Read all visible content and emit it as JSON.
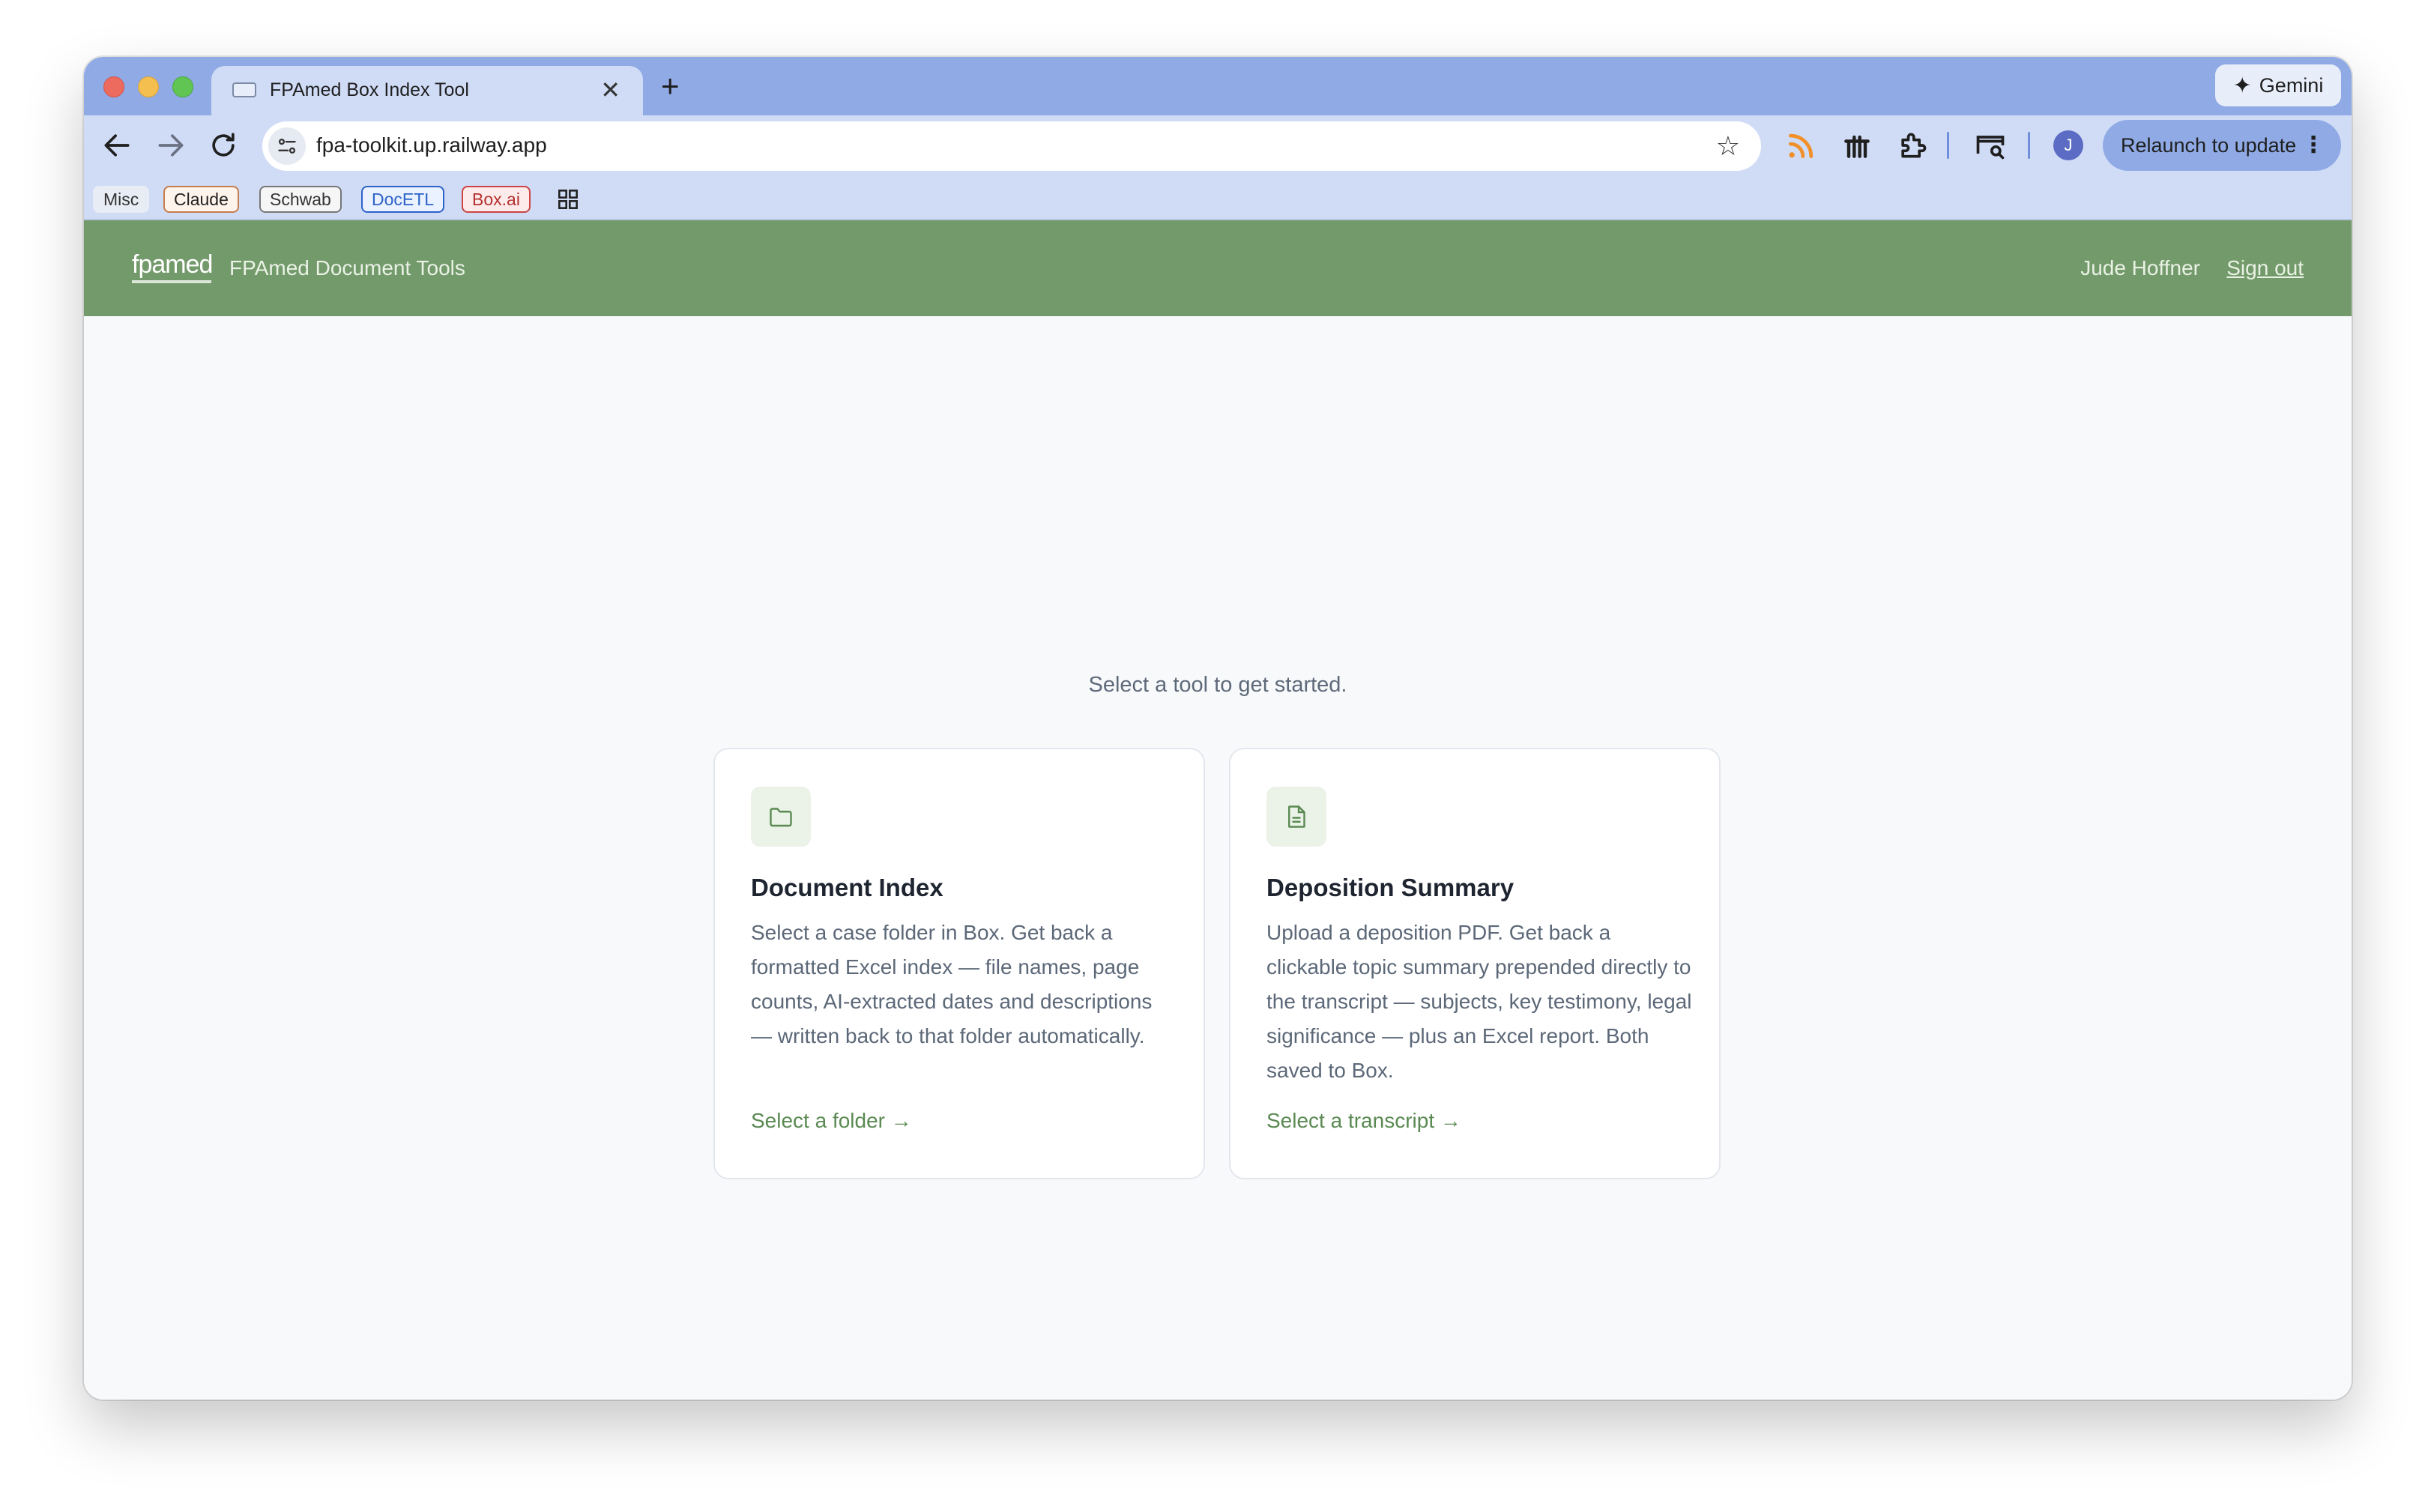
{
  "browser": {
    "tab_title": "FPAmed Box Index Tool",
    "tab_close": "✕",
    "new_tab": "+",
    "gemini_label": "Gemini",
    "url": "fpa-toolkit.up.railway.app",
    "avatar_initial": "J",
    "relaunch_label": "Relaunch to update",
    "bookmarks": [
      "Misc",
      "Claude",
      "Schwab",
      "DocETL",
      "Box.ai"
    ]
  },
  "header": {
    "logo": "fpamed",
    "app_title": "FPAmed Document Tools",
    "user_name": "Jude Hoffner",
    "sign_out": "Sign out"
  },
  "main": {
    "prompt": "Select a tool to get started.",
    "cards": [
      {
        "icon": "folder-icon",
        "title": "Document Index",
        "description": "Select a case folder in Box. Get back a formatted Excel index — file names, page counts, AI-extracted dates and descriptions — written back to that folder automatically.",
        "link": "Select a folder →"
      },
      {
        "icon": "document-icon",
        "title": "Deposition Summary",
        "description": "Upload a deposition PDF. Get back a clickable topic summary prepended directly to the transcript — subjects, key testimony, legal significance — plus an Excel report. Both saved to Box.",
        "link": "Select a transcript →"
      }
    ]
  },
  "colors": {
    "tabstrip": "#8faae4",
    "toolbar": "#d0dcf6",
    "header_green": "#739a6a",
    "link_green": "#5a8a52"
  }
}
